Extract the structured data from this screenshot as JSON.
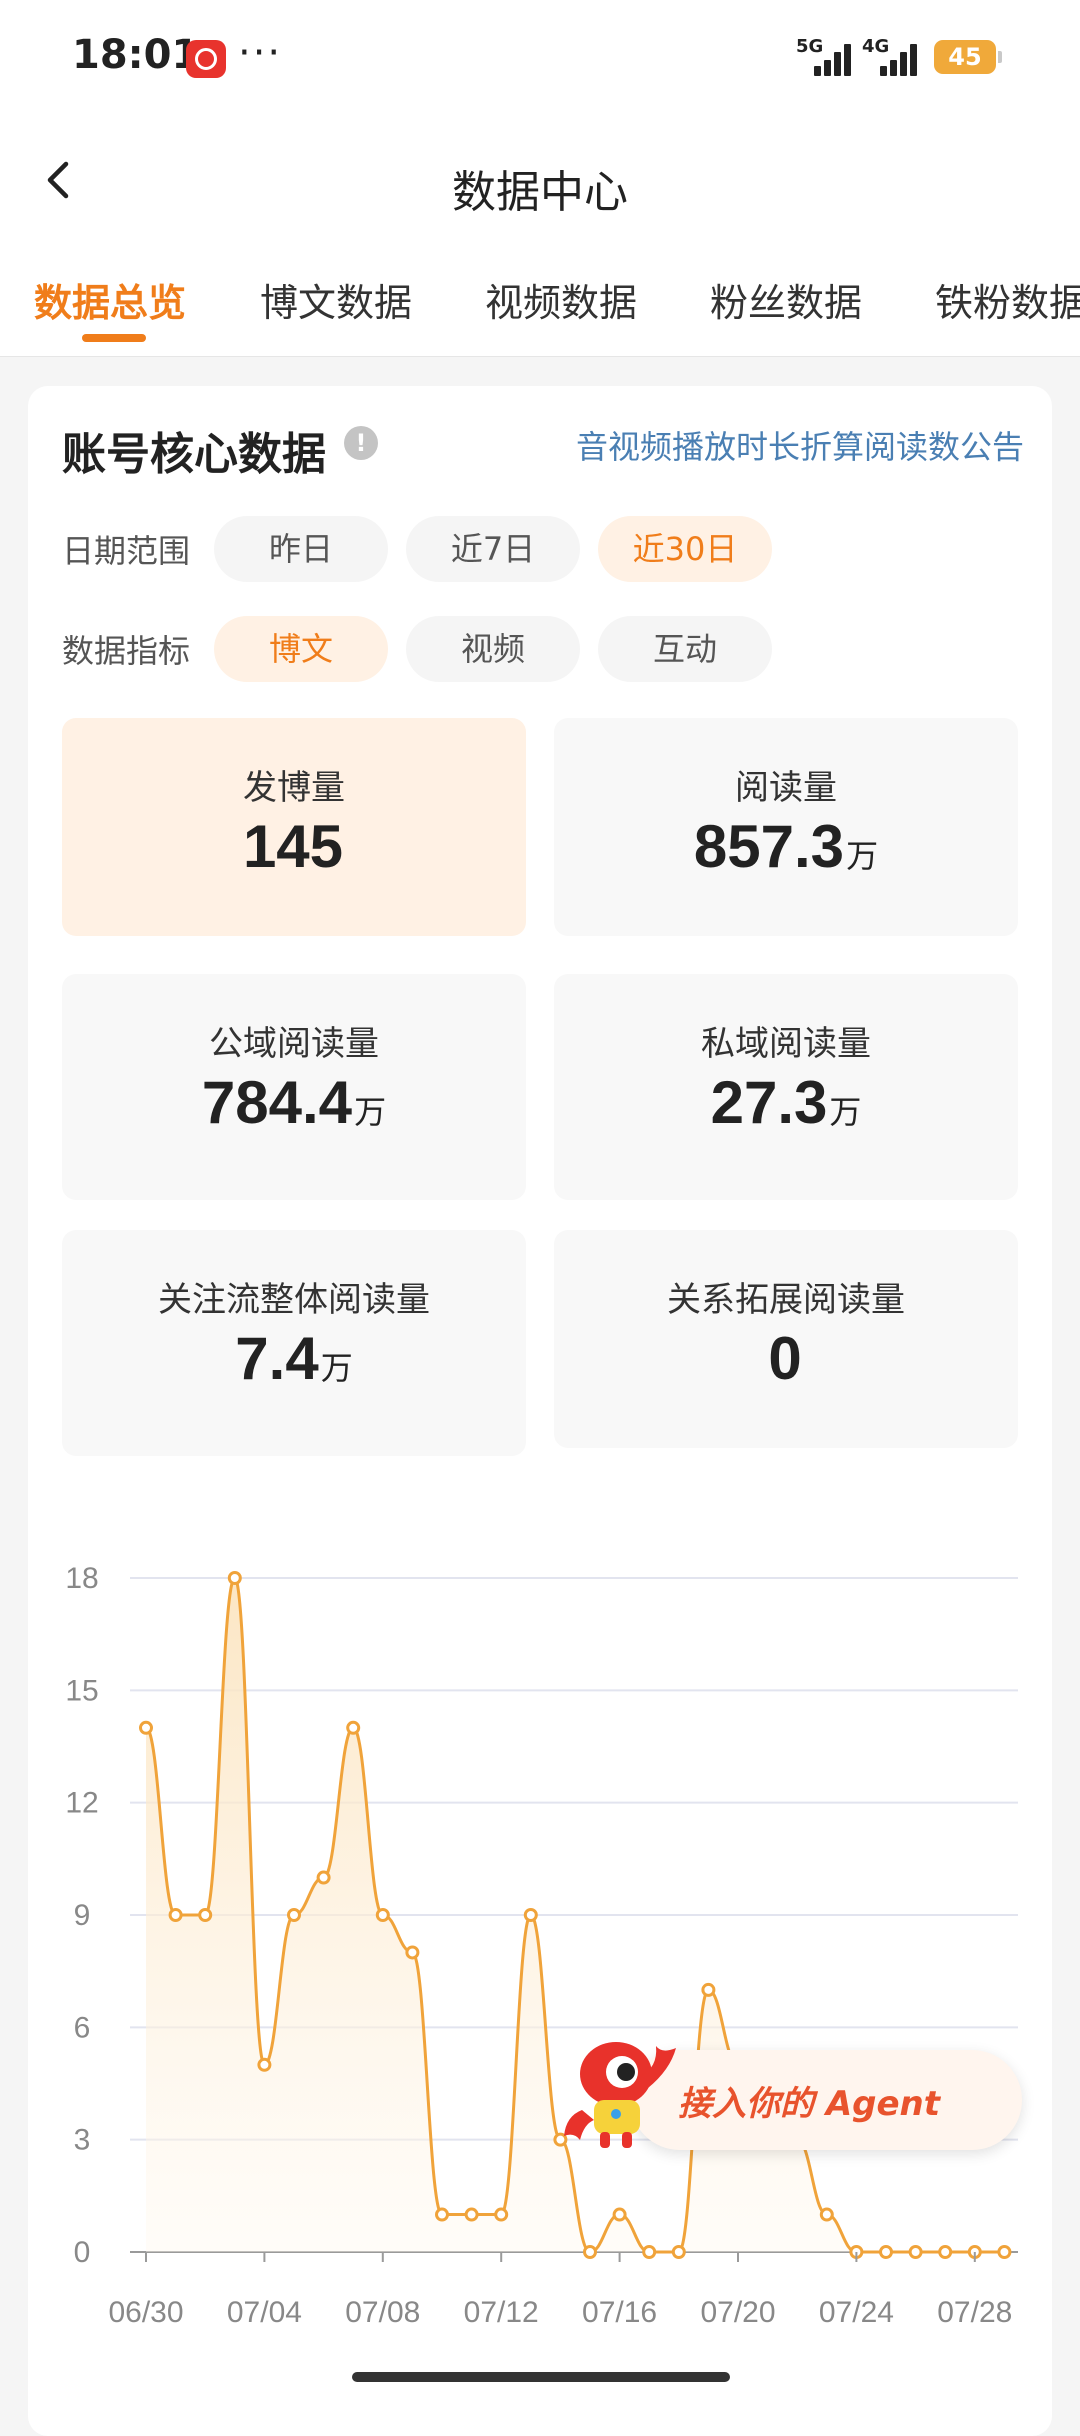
{
  "status_bar": {
    "time": "18:01",
    "network_1": "5G",
    "network_2": "4G",
    "battery": "45"
  },
  "header": {
    "title": "数据中心"
  },
  "tabs": [
    {
      "label": "数据总览"
    },
    {
      "label": "博文数据"
    },
    {
      "label": "视频数据"
    },
    {
      "label": "粉丝数据"
    },
    {
      "label": "铁粉数据"
    }
  ],
  "card": {
    "title": "账号核心数据",
    "notice_link": "音视频播放时长折算阅读数公告",
    "date_range": {
      "label": "日期范围",
      "options": [
        "昨日",
        "近7日",
        "近30日"
      ],
      "selected": "近30日"
    },
    "metric": {
      "label": "数据指标",
      "options": [
        "博文",
        "视频",
        "互动"
      ],
      "selected": "博文"
    },
    "stats": [
      {
        "label": "发博量",
        "value": "145",
        "unit": ""
      },
      {
        "label": "阅读量",
        "value": "857.3",
        "unit": "万"
      },
      {
        "label": "公域阅读量",
        "value": "784.4",
        "unit": "万"
      },
      {
        "label": "私域阅读量",
        "value": "27.3",
        "unit": "万"
      },
      {
        "label": "关注流整体阅读量",
        "value": "7.4",
        "unit": "万"
      },
      {
        "label": "关系拓展阅读量",
        "value": "0",
        "unit": ""
      }
    ]
  },
  "agent_badge": {
    "label": "接入你的 Agent"
  },
  "colors": {
    "accent": "#f07d1a",
    "line": "#f0a33a",
    "link": "#4a7fb3"
  },
  "chart_data": {
    "type": "area",
    "x": [
      "06/30",
      "07/01",
      "07/02",
      "07/03",
      "07/04",
      "07/05",
      "07/06",
      "07/07",
      "07/08",
      "07/09",
      "07/10",
      "07/11",
      "07/12",
      "07/13",
      "07/14",
      "07/15",
      "07/16",
      "07/17",
      "07/18",
      "07/19",
      "07/20",
      "07/21",
      "07/22",
      "07/23",
      "07/24",
      "07/25",
      "07/26",
      "07/27",
      "07/28",
      "07/29"
    ],
    "values": [
      14,
      9,
      9,
      18,
      5,
      9,
      10,
      14,
      9,
      8,
      1,
      1,
      1,
      9,
      3,
      0,
      1,
      0,
      0,
      7,
      5,
      5,
      3,
      1,
      0,
      0,
      0,
      0,
      0,
      0
    ],
    "x_tick_labels": [
      "06/30",
      "07/04",
      "07/08",
      "07/12",
      "07/16",
      "07/20",
      "07/24",
      "07/28"
    ],
    "y_ticks": [
      0,
      3,
      6,
      9,
      12,
      15,
      18
    ],
    "ylim": [
      0,
      18
    ],
    "grid": true,
    "title": "",
    "xlabel": "",
    "ylabel": ""
  }
}
